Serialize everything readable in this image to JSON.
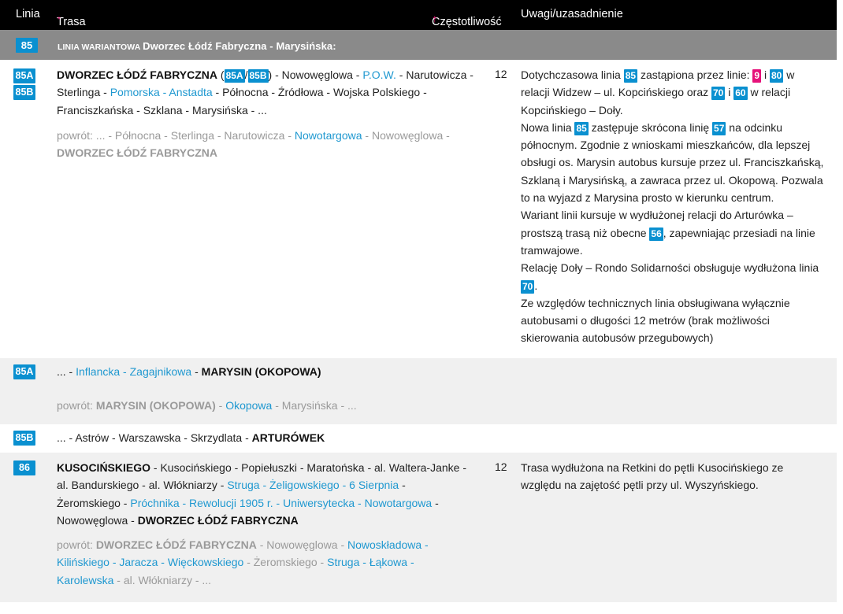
{
  "header": {
    "linia": "Linia",
    "trasa": "Trasa",
    "trasa_mark": "*",
    "czestotliwosc": "Częstotliwość",
    "czestotliwosc_mark": "†",
    "uwagi": "Uwagi/uzasadnienie"
  },
  "section_85": {
    "badge": "85",
    "title_prefix": "linia wariantowa",
    "title_main": "Dworzec Łódź Fabryczna - Marysińska:"
  },
  "row_85ab": {
    "badge_a": "85A",
    "badge_b": "85B",
    "route_start": "DWORZEC ŁÓDŹ FABRYCZNA",
    "paren_open": " (",
    "ib_a": "85A",
    "slash": "/",
    "ib_b": "85B",
    "paren_close": ")",
    "seg1": " - Nowowęglowa - ",
    "pow": "P.O.W.",
    "seg2": " - Narutowicza - Sterlinga - ",
    "pomorska": "Pomorska - Anstadta",
    "seg3": " - Północna - Źródłowa - Wojska Polskiego - Franciszkańska - Szklana - Marysińska - ...",
    "return_1": "powrót: ... - Północna - Sterlinga - Narutowicza - ",
    "return_blue": "Nowotargowa",
    "return_2": " - Nowowęglowa - ",
    "return_end": "DWORZEC ŁÓDŹ FABRYCZNA",
    "freq": "12",
    "notes": {
      "p1a": "Dotychczasowa linia ",
      "b85": "85",
      "p1b": " zastąpiona przez linie: ",
      "b9": "9",
      "p1c": " i ",
      "b80": "80",
      "p1d": " w relacji Widzew – ul. Kopcińskiego oraz ",
      "b70": "70",
      "p1e": " i ",
      "b60": "60",
      "p1f": " w relacji Kopcińskiego – Doły.",
      "p2a": "Nowa linia ",
      "b85b": "85",
      "p2b": " zastępuje skrócona linię ",
      "b57": "57",
      "p2c": " na odcinku północnym. Zgodnie z wnioskami mieszkańców, dla lepszej obsługi os. Marysin autobus kursuje przez ul. Franciszkańską, Szklaną i Marysińską, a zawraca przez ul. Okopową. Pozwala to na wyjazd z Marysina prosto w kierunku centrum.",
      "p3a": "Wariant linii kursuje w wydłużonej relacji do Arturówka – prostszą trasą niż obecne ",
      "b56": "56",
      "p3b": ", zapewniając przesiadi na linie tramwajowe.",
      "p4a": "Relację Doły – Rondo Solidarności obsługuje wydłużona linia ",
      "b70b": "70",
      "p4b": ".",
      "p5": "Ze względów technicznych linia obsługiwana wyłącznie autobusami o długości 12 metrów (brak możliwości skierowania autobusów przegubowych)"
    }
  },
  "row_85a": {
    "badge": "85A",
    "r1": "... - ",
    "r1_blue": "Inflancka - Zagajnikowa",
    "r1_sep": " - ",
    "r1_end": "MARYSIN (OKOPOWA)",
    "ret_pre": "powrót: ",
    "ret_b": "MARYSIN (OKOPOWA)",
    "ret_sep": " - ",
    "ret_blue": "Okopowa",
    "ret_end": " - Marysińska - ..."
  },
  "row_85b": {
    "badge": "85B",
    "r1": "... - Astrów - Warszawska - Skrzydlata - ",
    "r1_end": "ARTURÓWEK"
  },
  "row_86": {
    "badge": "86",
    "start": "KUSOCIŃSKIEGO",
    "s1": " - Kusocińskiego - Popiełuszki - Maratońska - al. Waltera-Janke - al. Bandurskiego - al. Włókniarzy - ",
    "b1": "Struga - Żeligowskiego - 6 Sierpnia",
    "s2": " - Żeromskiego - ",
    "b2": "Próchnika - Rewolucji 1905 r. - Uniwersytecka - Nowotargowa",
    "s3": " - Nowowęglowa - ",
    "end": "DWORZEC ŁÓDŹ FABRYCZNA",
    "ret_pre": "powrót: ",
    "ret_b": "DWORZEC ŁÓDŹ FABRYCZNA",
    "ret_1": " - Nowowęglowa - ",
    "ret_blue1": "Nowoskładowa - Kilińskiego - Jaracza - Więckowskiego",
    "ret_2": " - Żeromskiego - ",
    "ret_blue2": "Struga - Łąkowa - Karolewska",
    "ret_3": " - al. Włókniarzy - ...",
    "freq": "12",
    "notes": "Trasa wydłużona na Retkini do pętli Kusocińskiego ze względu na zajętość pętli przy ul. Wyszyńskiego."
  },
  "colors": {
    "accent": "#0a90d0",
    "pink": "#e6127a",
    "header_bg": "#000000",
    "section_bg": "#8a8a8a",
    "row_alt": "#f0f0f0"
  }
}
